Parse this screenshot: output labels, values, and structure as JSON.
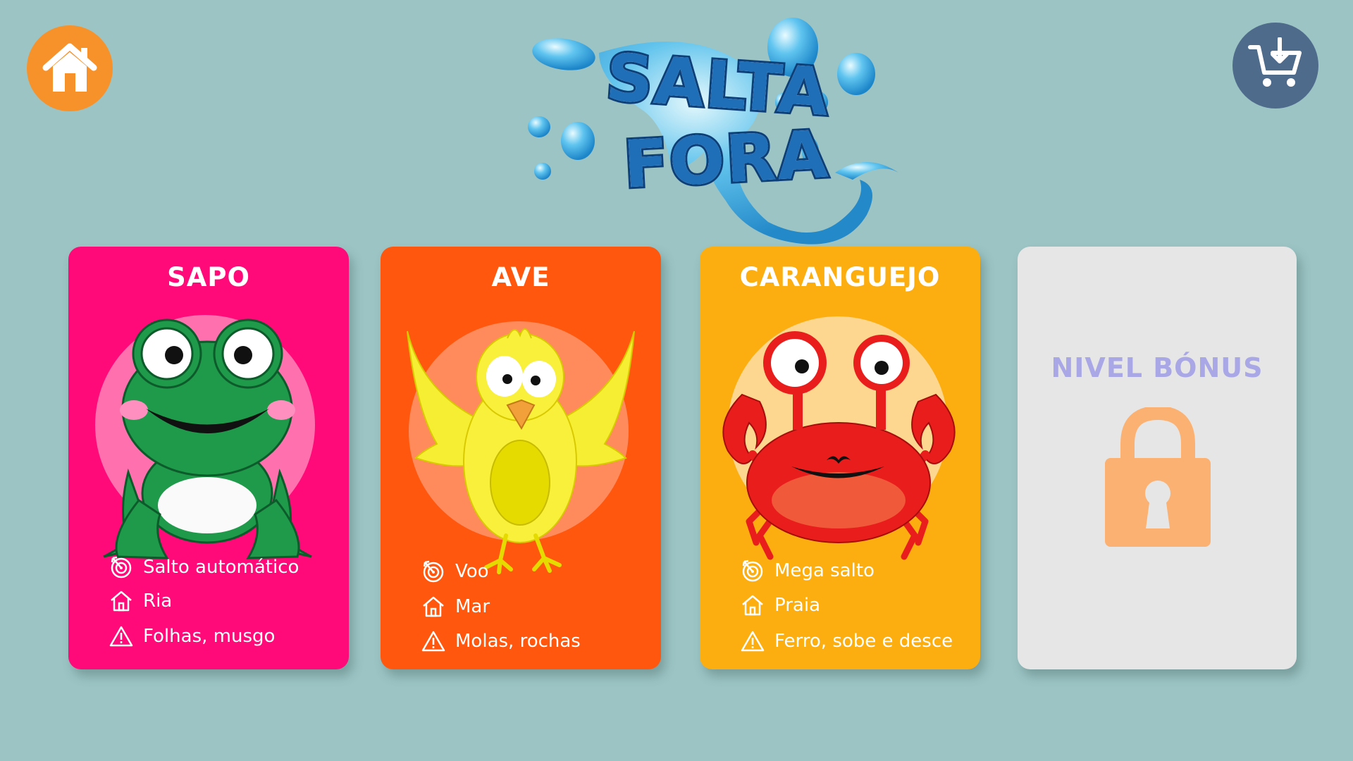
{
  "top_bar": {
    "home_icon": "home-icon",
    "shop_icon": "cart-download-icon"
  },
  "logo": {
    "line1": "SALTA",
    "line2": "FORA"
  },
  "cards": [
    {
      "title": "SAPO",
      "color": "#ff0a78",
      "character": "frog",
      "attributes": {
        "ability": "Salto automático",
        "habitat": "Ria",
        "hazards": "Folhas, musgo"
      }
    },
    {
      "title": "AVE",
      "color": "#ff570d",
      "character": "bird",
      "attributes": {
        "ability": "Voo",
        "habitat": "Mar",
        "hazards": "Molas, rochas"
      }
    },
    {
      "title": "CARANGUEJO",
      "color": "#fcae11",
      "character": "crab",
      "attributes": {
        "ability": "Mega salto",
        "habitat": "Praia",
        "hazards": "Ferro, sobe e desce"
      }
    }
  ],
  "bonus_card": {
    "title": "NIVEL BÓNUS",
    "locked": true,
    "lock_icon": "padlock-icon"
  }
}
